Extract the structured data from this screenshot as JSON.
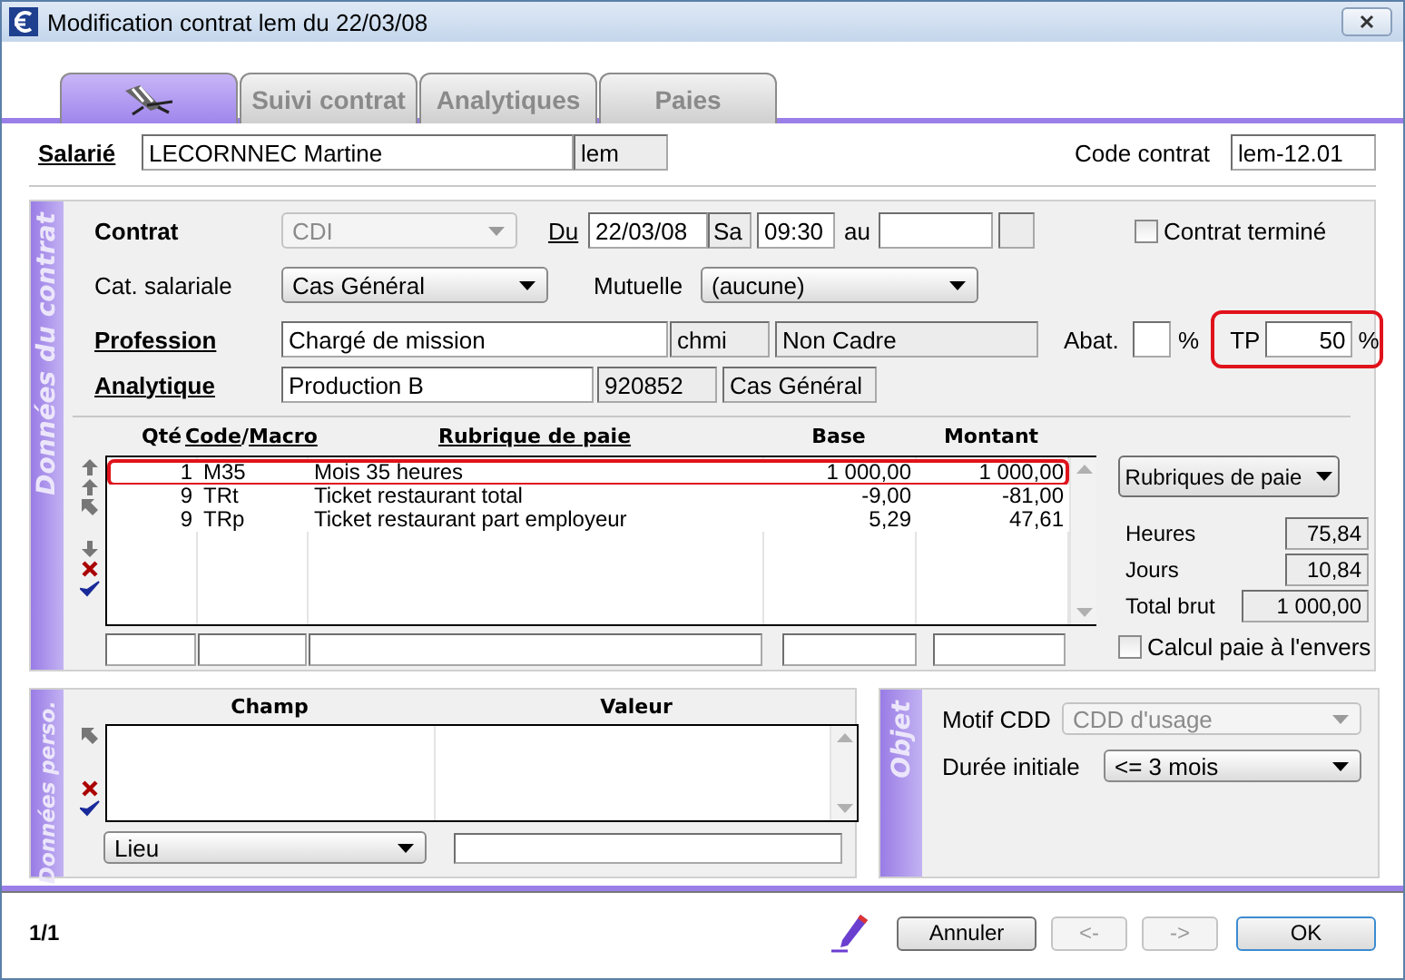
{
  "window": {
    "title": "Modification contrat lem du 22/03/08"
  },
  "tabs": [
    {
      "kind": "icon",
      "selected": true
    },
    {
      "kind": "text",
      "label": "Suivi contrat",
      "selected": false
    },
    {
      "kind": "text",
      "label": "Analytiques",
      "selected": false
    },
    {
      "kind": "text",
      "label": "Paies",
      "selected": false
    }
  ],
  "employee": {
    "label": "Salarié",
    "name": "LECORNNEC Martine",
    "code": "lem"
  },
  "contract_code": {
    "label": "Code contrat",
    "value": "lem-12.01"
  },
  "contract_section": {
    "title": "Données du contrat",
    "contrat": {
      "label": "Contrat",
      "value": "CDI",
      "disabled": true
    },
    "du": {
      "label": "Du",
      "date": "22/03/08",
      "day": "Sa",
      "time": "09:30"
    },
    "au": {
      "label": "au"
    },
    "terminated": {
      "label": "Contrat terminé",
      "checked": false
    },
    "category": {
      "label": "Cat. salariale",
      "value": "Cas Général",
      "disabled": false
    },
    "mutuelle": {
      "label": "Mutuelle",
      "value": "(aucune)",
      "disabled": false
    },
    "profession": {
      "label": "Profession",
      "value": "Chargé de mission",
      "code": "chmi",
      "status": "Non Cadre"
    },
    "abat": {
      "label": "Abat.",
      "unit": "%"
    },
    "tp": {
      "label": "TP",
      "value": "50",
      "unit": "%",
      "highlighted": true
    },
    "analytique": {
      "label": "Analytique",
      "value": "Production B",
      "code": "920852",
      "category": "Cas Général"
    },
    "table": {
      "qty_header": "Qté",
      "code_header": {
        "code": "Code",
        "separator": "/",
        "macro": "Macro"
      },
      "label_header": "Rubrique de paie",
      "base_header": "Base",
      "amount_header": "Montant",
      "rows": [
        {
          "qty": "1",
          "code": "M35",
          "label": "Mois 35 heures",
          "base": "1 000,00",
          "amount": "1 000,00",
          "highlighted": true
        },
        {
          "qty": "9",
          "code": "TRt",
          "label": "Ticket restaurant total",
          "base": "-9,00",
          "amount": "-81,00",
          "highlighted": false
        },
        {
          "qty": "9",
          "code": "TRp",
          "label": "Ticket restaurant part employeur",
          "base": "5,29",
          "amount": "47,61",
          "highlighted": false
        }
      ]
    },
    "rubriques_button": "Rubriques de paie",
    "totals": [
      {
        "label": "Heures",
        "value": "75,84"
      },
      {
        "label": "Jours",
        "value": "10,84"
      },
      {
        "label": "Total brut",
        "value": "1 000,00"
      }
    ],
    "reverse": {
      "label": "Calcul paie à l'envers",
      "checked": false
    }
  },
  "perso_section": {
    "title": "Données perso.",
    "columns": [
      "Champ",
      "Valeur"
    ],
    "field": {
      "value": "Lieu"
    }
  },
  "objet_section": {
    "title": "Objet",
    "motif": {
      "label": "Motif CDD",
      "value": "CDD d'usage",
      "disabled": true
    },
    "duree": {
      "label": "Durée initiale",
      "value": "<= 3 mois",
      "disabled": false
    }
  },
  "footer": {
    "page": "1/1",
    "buttons": [
      {
        "label": "Annuler",
        "disabled": false,
        "default": false
      },
      {
        "label": "<-",
        "disabled": true,
        "default": false
      },
      {
        "label": "->",
        "disabled": true,
        "default": false
      },
      {
        "label": "OK",
        "disabled": false,
        "default": true
      }
    ]
  }
}
